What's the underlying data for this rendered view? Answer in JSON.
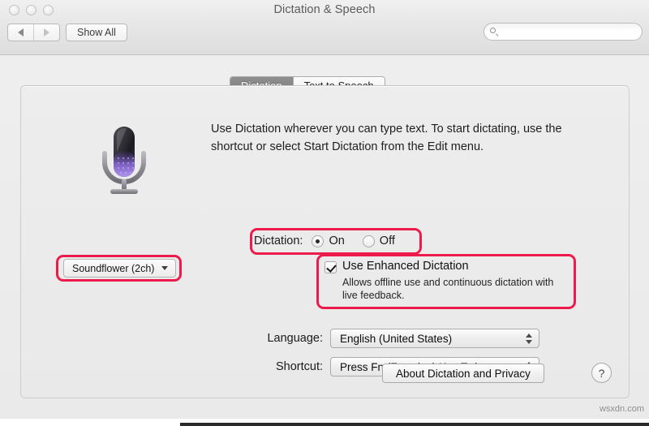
{
  "window": {
    "title": "Dictation & Speech",
    "traffic_lights": [
      "close",
      "minimize",
      "zoom"
    ]
  },
  "toolbar": {
    "back_label": "Back",
    "forward_label": "Forward",
    "show_all_label": "Show All",
    "search": {
      "value": "",
      "placeholder": "",
      "icon": "search-icon"
    }
  },
  "tabs": [
    {
      "label": "Dictation",
      "selected": true
    },
    {
      "label": "Text to Speech",
      "selected": false
    }
  ],
  "main": {
    "mic_icon": "microphone-icon",
    "headline": "Use Dictation wherever you can type text. To start dictating, use the shortcut or select Start Dictation from the Edit menu.",
    "source_popup": {
      "value": "Soundflower (2ch)",
      "icon": "chevron-down-icon"
    },
    "dictation": {
      "label": "Dictation:",
      "options": [
        {
          "label": "On",
          "selected": true
        },
        {
          "label": "Off",
          "selected": false
        }
      ]
    },
    "enhanced": {
      "checked": true,
      "title": "Use Enhanced Dictation",
      "description": "Allows offline use and continuous dictation with live feedback."
    },
    "language": {
      "label": "Language:",
      "value": "English (United States)"
    },
    "shortcut": {
      "label": "Shortcut:",
      "value": "Press Fn (Function) Key Twice"
    },
    "about_button": "About Dictation and Privacy",
    "help_button": "?"
  },
  "annotations": {
    "color": "#ec1b4b",
    "boxes": [
      "source-popup",
      "dictation-radio-row",
      "enhanced-dictation-block"
    ]
  },
  "watermark": "wsxdn.com"
}
